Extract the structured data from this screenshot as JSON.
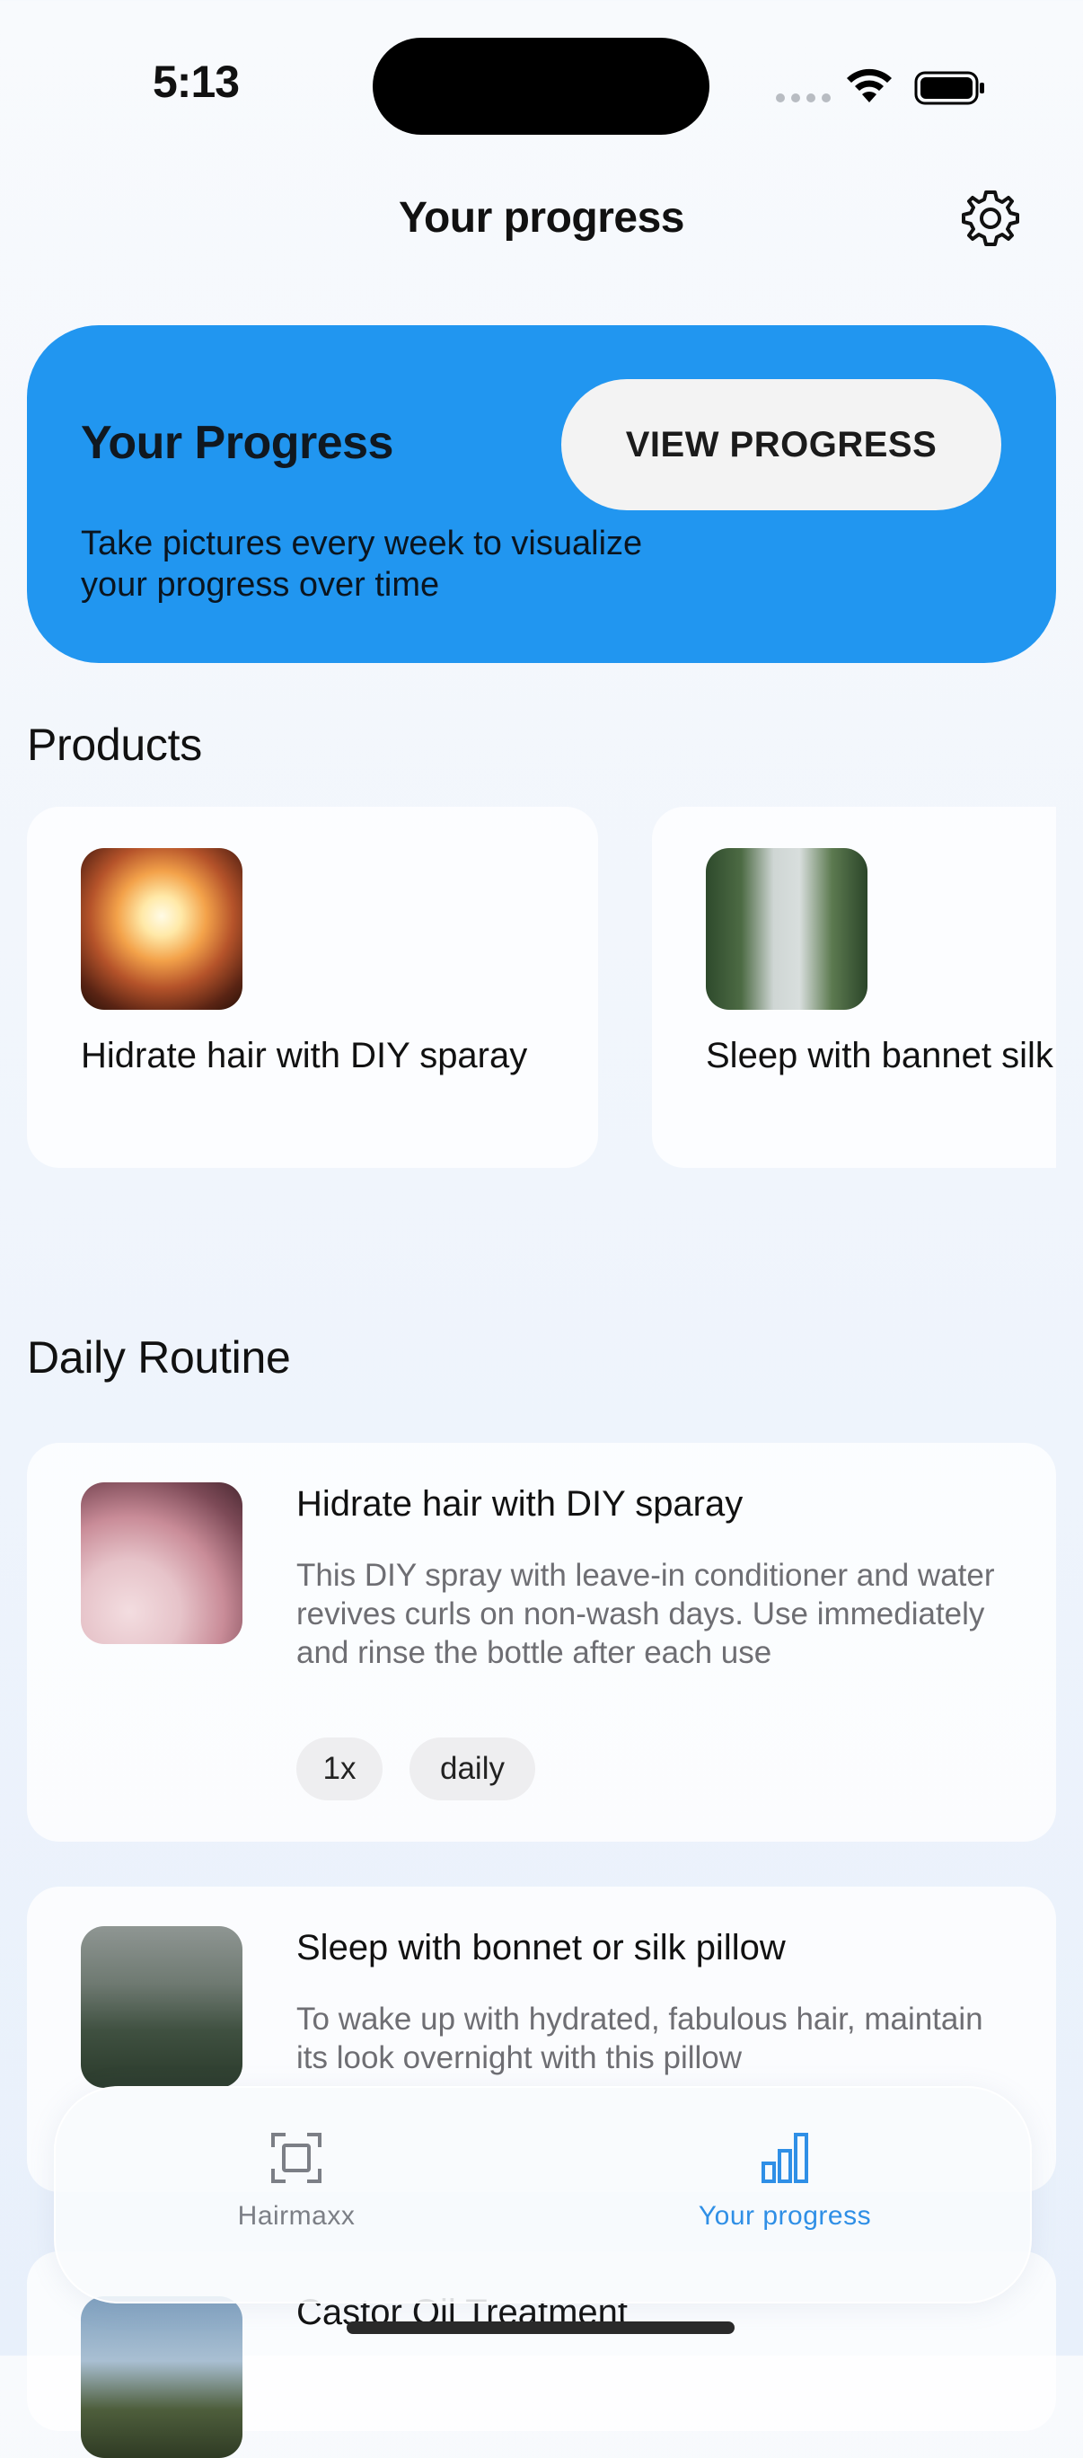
{
  "status_bar": {
    "time": "5:13"
  },
  "header": {
    "title": "Your progress"
  },
  "progress_card": {
    "title": "Your Progress",
    "description": "Take pictures every week to visualize your progress over time",
    "button_label": "VIEW PROGRESS",
    "color": "#2196f0"
  },
  "products": {
    "heading": "Products",
    "items": [
      {
        "label": "Hidrate hair with DIY sparay",
        "image": "building-sky-photo"
      },
      {
        "label": "Sleep with bannet silk pillow",
        "image": "trees-fog-photo"
      }
    ]
  },
  "routine": {
    "heading": "Daily Routine",
    "items": [
      {
        "title": "Hidrate hair with DIY sparay",
        "description": "This DIY spray with leave-in conditioner and water revives curls on non-wash days. Use immediately and rinse the bottle after each use",
        "tags": [
          "1x",
          "daily"
        ],
        "image": "blossom-branches-photo"
      },
      {
        "title": "Sleep with bonnet or silk pillow",
        "description": "To wake up with hydrated, fabulous hair, maintain its look overnight with this pillow",
        "image": "misty-forest-photo"
      },
      {
        "title": "Castor Oil Treatment",
        "image": "landscape-photo"
      }
    ]
  },
  "tab_bar": {
    "tabs": [
      {
        "label": "Hairmaxx",
        "icon": "scan-icon",
        "active": false
      },
      {
        "label": "Your progress",
        "icon": "bar-chart-icon",
        "active": true
      }
    ],
    "active_color": "#2f8fe6",
    "inactive_color": "#7c7f86"
  }
}
